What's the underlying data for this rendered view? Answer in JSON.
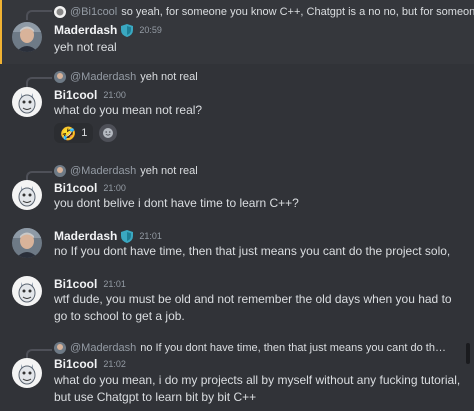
{
  "messages": [
    {
      "reply": {
        "user": "@Bi1cool",
        "text": "so yeah, for someone you know C++, Chatgpt is a no no, but for someone ..."
      },
      "author": "Maderdash",
      "time": "20:59",
      "text": "yeh not real"
    },
    {
      "reply": {
        "user": "@Maderdash",
        "text": "yeh not real"
      },
      "author": "Bi1cool",
      "time": "21:00",
      "text": "what do you mean not real?",
      "reactions": [
        {
          "emoji": "🤣",
          "count": "1"
        }
      ]
    },
    {
      "reply": {
        "user": "@Maderdash",
        "text": "yeh not real"
      },
      "author": "Bi1cool",
      "time": "21:00",
      "text": "you dont belive i dont have time to learn C++?"
    },
    {
      "author": "Maderdash",
      "time": "21:01",
      "text": "no If you dont have time, then that just means you cant do the project solo,"
    },
    {
      "author": "Bi1cool",
      "time": "21:01",
      "text_line1": "wtf dude, you must be old and not remember the old days when you had to",
      "text_line2": "go to school to get a job."
    },
    {
      "reply": {
        "user": "@Maderdash",
        "text": "no If you dont have time, then that just means you cant do the project..."
      },
      "author": "Bi1cool",
      "time": "21:02",
      "text_line1": "what do you mean, i do my projects all by myself without any fucking tutorial,",
      "text_line2": "but use Chatgpt to learn bit by bit C++"
    }
  ],
  "colors": {
    "background": "#313338",
    "highlight": "#35373c",
    "mention_bar": "#f0b232",
    "username": "#f2f3f5",
    "timestamp": "#949ba4",
    "text": "#dbdee1"
  }
}
